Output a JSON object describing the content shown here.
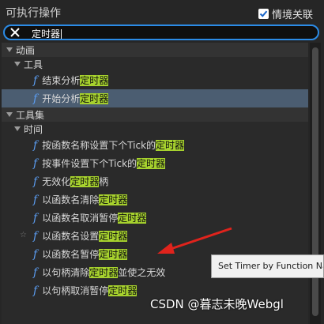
{
  "header": {
    "title": "可执行操作",
    "context_label": "情境关联",
    "context_checked": true
  },
  "search": {
    "value": "定时器"
  },
  "tree": [
    {
      "kind": "category",
      "label": "动画",
      "indent": 1
    },
    {
      "kind": "sub",
      "label": "工具",
      "indent": 2
    },
    {
      "kind": "fn",
      "indent": 3,
      "pre": "结束分析",
      "hl": "定时器",
      "post": ""
    },
    {
      "kind": "fn",
      "indent": 3,
      "pre": "开始分析",
      "hl": "定时器",
      "post": "",
      "selected": true
    },
    {
      "kind": "category",
      "label": "工具集",
      "indent": 1
    },
    {
      "kind": "sub",
      "label": "时间",
      "indent": 2
    },
    {
      "kind": "fn",
      "indent": 3,
      "pre": "按函数名称设置下个Tick的",
      "hl": "定时器",
      "post": ""
    },
    {
      "kind": "fn",
      "indent": 3,
      "pre": "按事件设置下个Tick的",
      "hl": "定时器",
      "post": ""
    },
    {
      "kind": "fn",
      "indent": 3,
      "pre": "无效化",
      "hl": "定时器",
      "post": "柄"
    },
    {
      "kind": "fn",
      "indent": 3,
      "pre": "以函数名清除",
      "hl": "定时器",
      "post": ""
    },
    {
      "kind": "fn",
      "indent": 3,
      "pre": "以函数名取消暂停",
      "hl": "定时器",
      "post": ""
    },
    {
      "kind": "fn",
      "indent": 3,
      "pre": "以函数名设置",
      "hl": "定时器",
      "post": "",
      "starred": true
    },
    {
      "kind": "fn",
      "indent": 3,
      "pre": "以函数名暂停",
      "hl": "定时器",
      "post": ""
    },
    {
      "kind": "fn",
      "indent": 3,
      "pre": "以句柄清除",
      "hl": "定时器",
      "post": "並使之无效"
    },
    {
      "kind": "fn",
      "indent": 3,
      "pre": "以句柄取消暂停",
      "hl": "定时器",
      "post": ""
    }
  ],
  "tooltip": {
    "text": "Set Timer by Function Na"
  },
  "watermark": {
    "text": "CSDN @暮志未晚Webgl"
  },
  "icons": {
    "function": "f",
    "star": "☆"
  },
  "colors": {
    "accent": "#2b8be6",
    "highlight": "#a7d22e",
    "function_icon": "#5b9cf0",
    "selected_row": "#4b5d71",
    "arrow": "#e0231c"
  }
}
